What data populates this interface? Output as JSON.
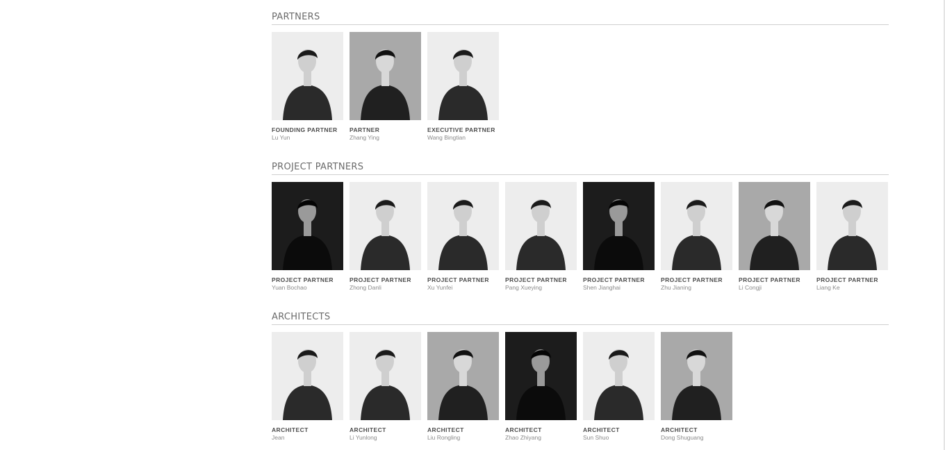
{
  "sections": [
    {
      "title": "PARTNERS",
      "members": [
        {
          "role": "FOUNDING PARTNER",
          "name": "Lu Yun",
          "tone": "light"
        },
        {
          "role": "PARTNER",
          "name": "Zhang Ying",
          "tone": "mid"
        },
        {
          "role": "EXECUTIVE PARTNER",
          "name": "Wang Bingtian",
          "tone": "light"
        }
      ]
    },
    {
      "title": "PROJECT PARTNERS",
      "members": [
        {
          "role": "PROJECT PARTNER",
          "name": "Yuan Bochao",
          "tone": "dark"
        },
        {
          "role": "PROJECT PARTNER",
          "name": "Zhong Danli",
          "tone": "light"
        },
        {
          "role": "PROJECT PARTNER",
          "name": "Xu Yunfei",
          "tone": "light"
        },
        {
          "role": "PROJECT PARTNER",
          "name": "Pang Xueying",
          "tone": "light"
        },
        {
          "role": "PROJECT PARTNER",
          "name": "Shen Jianghai",
          "tone": "dark"
        },
        {
          "role": "PROJECT PARTNER",
          "name": "Zhu Jianing",
          "tone": "light"
        },
        {
          "role": "PROJECT PARTNER",
          "name": "Li Congji",
          "tone": "mid"
        },
        {
          "role": "PROJECT PARTNER",
          "name": "Liang Ke",
          "tone": "light"
        }
      ]
    },
    {
      "title": "ARCHITECTS",
      "members": [
        {
          "role": "ARCHITECT",
          "name": "Jean",
          "tone": "light"
        },
        {
          "role": "ARCHITECT",
          "name": "Li Yunlong",
          "tone": "light"
        },
        {
          "role": "ARCHITECT",
          "name": "Liu Rongling",
          "tone": "mid"
        },
        {
          "role": "ARCHITECT",
          "name": "Zhao Zhiyang",
          "tone": "dark"
        },
        {
          "role": "ARCHITECT",
          "name": "Sun Shuo",
          "tone": "light"
        },
        {
          "role": "ARCHITECT",
          "name": "Dong Shuguang",
          "tone": "mid"
        }
      ]
    }
  ]
}
